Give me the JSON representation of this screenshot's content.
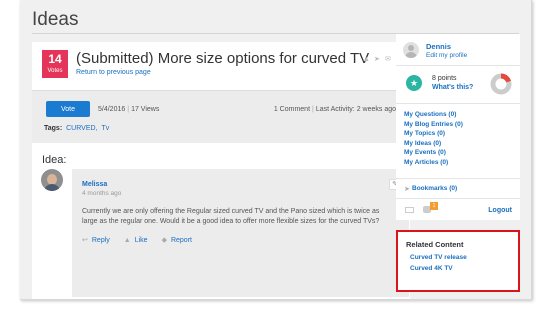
{
  "page": {
    "title": "Ideas"
  },
  "idea": {
    "vote_count": "14",
    "vote_count_label": "Votes",
    "title": "(Submitted) More size options for curved TV",
    "back_link": "Return to previous page",
    "vote_button": "Vote",
    "date": "5/4/2016",
    "views": "17 Views",
    "comments": "1 Comment",
    "last_activity": "Last Activity: 2 weeks ago",
    "tags_label": "Tags:",
    "tags": [
      "CURVED,",
      "Tv"
    ],
    "section_label": "Idea:"
  },
  "comment": {
    "author": "Melissa",
    "time": "4 months ago",
    "body": "Currently we are only offering the Regular sized curved TV and the Pano sized which is twice as large as the regular one. Would it be a good idea to offer more flexible sizes for the curved TVs?",
    "actions": {
      "reply": "Reply",
      "like": "Like",
      "report": "Report"
    }
  },
  "sidebar": {
    "profile": {
      "name": "Dennis",
      "edit_link": "Edit my profile"
    },
    "points": {
      "value": "8 points",
      "link": "What's this?",
      "progress_fraction": 0.2
    },
    "links": [
      "My Questions (0)",
      "My Blog Entries (0)",
      "My Topics (0)",
      "My Ideas (0)",
      "My Events (0)",
      "My Articles (0)"
    ],
    "bookmarks": "Bookmarks (0)",
    "notification_count": "1",
    "logout": "Logout",
    "related": {
      "title": "Related Content",
      "items": [
        "Curved TV release",
        "Curved 4K TV"
      ]
    }
  },
  "colors": {
    "accent": "#1a7bd1",
    "vote_badge": "#e4345a",
    "star_badge": "#2bb5a3",
    "highlight_border": "#d9141a",
    "notification": "#f39c33"
  }
}
